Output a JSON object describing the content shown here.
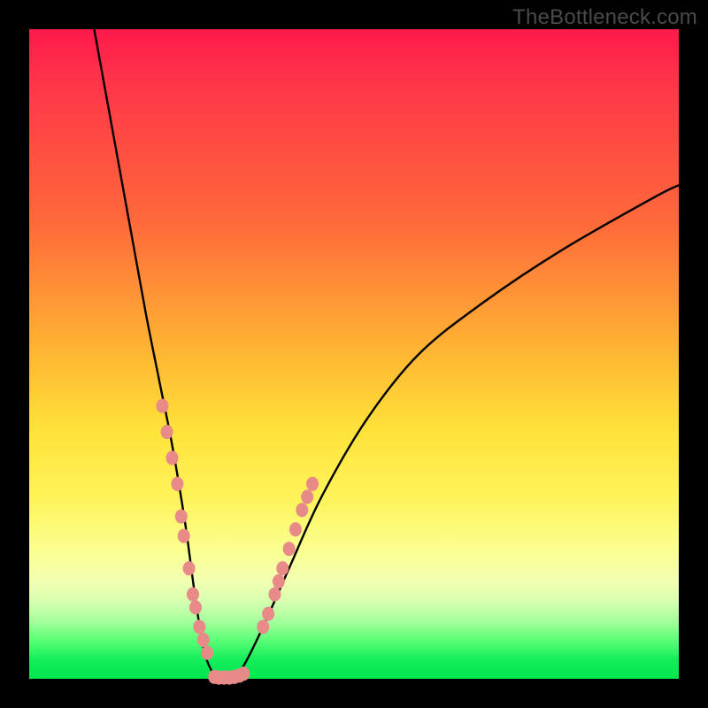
{
  "watermark": "TheBottleneck.com",
  "chart_data": {
    "type": "line",
    "title": "",
    "xlabel": "",
    "ylabel": "",
    "xlim": [
      0,
      100
    ],
    "ylim": [
      0,
      100
    ],
    "curve": {
      "name": "bottleneck-curve",
      "x": [
        10,
        12,
        14,
        16,
        18,
        20,
        22,
        24,
        25.5,
        27,
        29,
        31,
        33,
        36,
        40,
        45,
        52,
        60,
        70,
        82,
        96,
        100
      ],
      "y": [
        100,
        89,
        78,
        67,
        56,
        46,
        36,
        24,
        13,
        4,
        0,
        0,
        2,
        8,
        17,
        28,
        40,
        50,
        58,
        66,
        74,
        76
      ]
    },
    "points_left": {
      "name": "left-markers",
      "x": [
        20.5,
        21.2,
        22.0,
        22.8,
        23.4,
        23.8,
        24.6,
        25.2,
        25.6,
        26.2,
        26.8,
        27.4
      ],
      "y": [
        42,
        38,
        34,
        30,
        25,
        22,
        17,
        13,
        11,
        8,
        6,
        4
      ]
    },
    "points_right": {
      "name": "right-markers",
      "x": [
        36.0,
        36.8,
        37.8,
        38.4,
        39.0,
        40.0,
        41.0,
        42.0,
        42.8,
        43.6
      ],
      "y": [
        8,
        10,
        13,
        15,
        17,
        20,
        23,
        26,
        28,
        30
      ]
    },
    "points_bottom": {
      "name": "trough-markers",
      "x": [
        28.5,
        29.2,
        30.0,
        30.8,
        31.6,
        32.4,
        33.0
      ],
      "y": [
        0.3,
        0.2,
        0.2,
        0.2,
        0.3,
        0.5,
        0.8
      ]
    },
    "marker_color": "#e78a88",
    "curve_color": "#000000"
  }
}
